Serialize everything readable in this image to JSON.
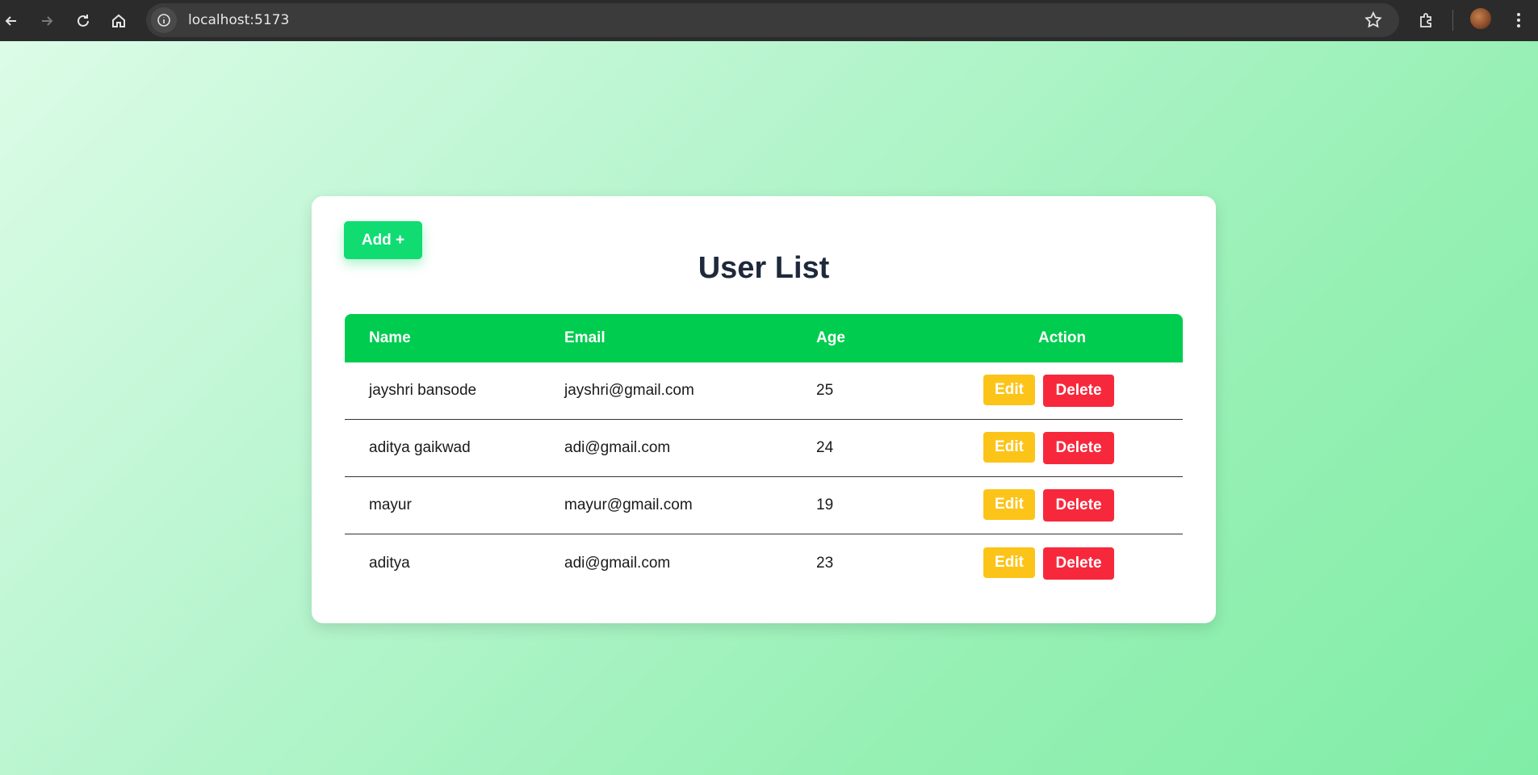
{
  "browser": {
    "url": "localhost:5173",
    "icons": [
      "back-icon",
      "forward-icon",
      "reload-icon",
      "home-icon",
      "site-info-icon",
      "bookmark-star-icon",
      "extensions-icon",
      "profile-avatar",
      "menu-icon"
    ]
  },
  "page": {
    "add_button_label": "Add +",
    "title": "User List",
    "columns": [
      "Name",
      "Email",
      "Age",
      "Action"
    ],
    "rows": [
      {
        "name": "jayshri bansode",
        "email": "jayshri@gmail.com",
        "age": "25"
      },
      {
        "name": "aditya gaikwad",
        "email": "adi@gmail.com",
        "age": "24"
      },
      {
        "name": "mayur",
        "email": "mayur@gmail.com",
        "age": "19"
      },
      {
        "name": "aditya",
        "email": "adi@gmail.com",
        "age": "23"
      }
    ],
    "edit_label": "Edit",
    "delete_label": "Delete"
  },
  "colors": {
    "add_button": "#10dc72",
    "table_header": "#00cc4f",
    "edit_button": "#fcc419",
    "delete_button": "#f7283c",
    "title_text": "#1e293b"
  }
}
